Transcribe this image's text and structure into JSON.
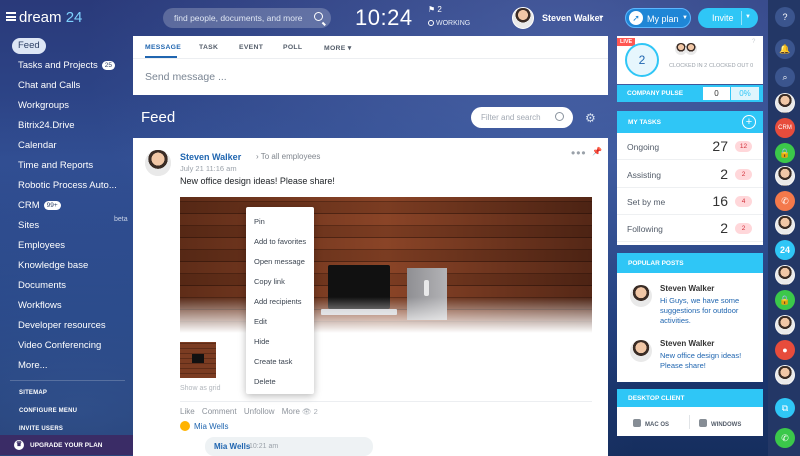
{
  "header": {
    "logo_main": "dream",
    "logo_num": "24",
    "search_placeholder": "find people, documents, and more",
    "time": "10:24",
    "flag_count": "2",
    "status": "WORKING",
    "user_name": "Steven Walker",
    "my_plan": "My plan",
    "invite": "Invite"
  },
  "menu": {
    "items": [
      {
        "label": "Feed",
        "active": true
      },
      {
        "label": "Tasks and Projects",
        "count": "25"
      },
      {
        "label": "Chat and Calls"
      },
      {
        "label": "Workgroups"
      },
      {
        "label": "Bitrix24.Drive"
      },
      {
        "label": "Calendar"
      },
      {
        "label": "Time and Reports"
      },
      {
        "label": "Robotic Process Auto..."
      },
      {
        "label": "CRM",
        "count": "99+"
      },
      {
        "label": "Sites"
      },
      {
        "label": "Employees"
      },
      {
        "label": "Knowledge base"
      },
      {
        "label": "Documents"
      },
      {
        "label": "Workflows"
      },
      {
        "label": "Developer resources"
      },
      {
        "label": "Video Conferencing"
      },
      {
        "label": "More..."
      }
    ],
    "beta": "beta",
    "sitemap": "SITEMAP",
    "configure": "CONFIGURE MENU",
    "invite_users": "INVITE USERS",
    "upgrade": "UPGRADE YOUR PLAN"
  },
  "composer": {
    "tabs": [
      "MESSAGE",
      "TASK",
      "EVENT",
      "POLL",
      "MORE"
    ],
    "placeholder": "Send message ..."
  },
  "feed": {
    "title": "Feed",
    "filter_placeholder": "Filter and search"
  },
  "post": {
    "author": "Steven Walker",
    "to": "To all employees",
    "date": "July 21 11:16 am",
    "text": "New office design ideas! Please share!",
    "show_as_grid": "Show as grid",
    "actions": [
      "Like",
      "Comment",
      "Unfollow",
      "More"
    ],
    "views": "2",
    "liker": "Mia Wells",
    "reply_author": "Mia Wells",
    "reply_time": "10:21 am"
  },
  "context_menu": [
    "Pin",
    "Add to favorites",
    "Open message",
    "Copy link",
    "Add recipients",
    "Edit",
    "Hide",
    "Create task",
    "Delete"
  ],
  "widgets": {
    "live": "LIVE",
    "ring_value": "2",
    "clocked_in": "CLOCKED IN",
    "clocked_in_count": "2",
    "clocked_out": "CLOCKED OUT",
    "clocked_out_count": "0",
    "pulse_label": "COMPANY PULSE",
    "pulse_value": "0",
    "pulse_percent": "0%",
    "tasks_title": "MY TASKS",
    "tasks": [
      {
        "label": "Ongoing",
        "value": "27",
        "badge": "12"
      },
      {
        "label": "Assisting",
        "value": "2",
        "badge": "2"
      },
      {
        "label": "Set by me",
        "value": "16",
        "badge": "4"
      },
      {
        "label": "Following",
        "value": "2",
        "badge": "2"
      }
    ],
    "popular_title": "POPULAR POSTS",
    "popular": [
      {
        "author": "Steven Walker",
        "text": "Hi Guys, we have some suggestions for outdoor activities."
      },
      {
        "author": "Steven Walker",
        "text": "New office design ideas! Please share!"
      }
    ],
    "desktop_title": "DESKTOP CLIENT",
    "mac": "MAC OS",
    "windows": "WINDOWS"
  },
  "rail": {
    "badge_24": "24",
    "crm": "CRM"
  },
  "colors": {
    "accent": "#2fc6f6",
    "link": "#2066b0",
    "badge": "#ffd7da"
  }
}
